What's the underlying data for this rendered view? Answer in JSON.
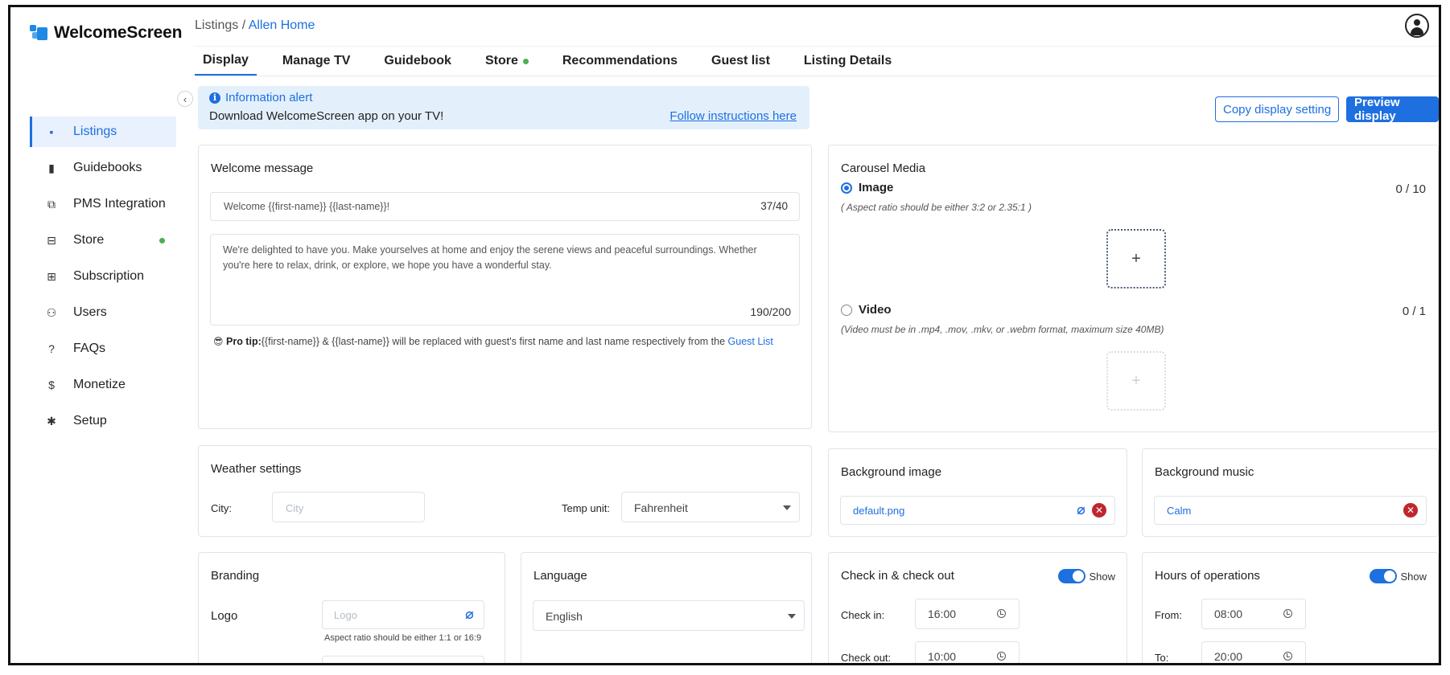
{
  "app": {
    "name": "WelcomeScreen"
  },
  "sidebar": {
    "items": [
      {
        "label": "Listings",
        "icon": "listings-icon",
        "glyph": "▪"
      },
      {
        "label": "Guidebooks",
        "icon": "book-icon",
        "glyph": "▮"
      },
      {
        "label": "PMS Integration",
        "icon": "puzzle-icon",
        "glyph": "⧉"
      },
      {
        "label": "Store",
        "icon": "store-icon",
        "glyph": "⊟"
      },
      {
        "label": "Subscription",
        "icon": "subscription-icon",
        "glyph": "⊞"
      },
      {
        "label": "Users",
        "icon": "users-icon",
        "glyph": "⚇"
      },
      {
        "label": "FAQs",
        "icon": "question-icon",
        "glyph": "?"
      },
      {
        "label": "Monetize",
        "icon": "dollar-icon",
        "glyph": "$"
      },
      {
        "label": "Setup",
        "icon": "gear-icon",
        "glyph": "✱"
      }
    ],
    "collapse_glyph": "‹"
  },
  "header": {
    "breadcrumb_root": "Listings /",
    "breadcrumb_current": "Allen Home"
  },
  "tabs": [
    "Display",
    "Manage TV",
    "Guidebook",
    "Store",
    "Recommendations",
    "Guest list",
    "Listing Details"
  ],
  "alert": {
    "title": "Information alert",
    "info_glyph": "i",
    "text": "Download WelcomeScreen app on your TV!",
    "link": "Follow instructions here"
  },
  "actions": {
    "copy": "Copy display setting",
    "preview": "Preview display"
  },
  "welcome": {
    "title": "Welcome message",
    "headline": "Welcome {{first-name}} {{last-name}}!",
    "headline_count": "37/40",
    "body": "We're delighted to have you. Make yourselves at home and enjoy the serene views and peaceful surroundings. Whether you're here to relax, drink, or explore, we hope you have a wonderful stay.",
    "body_count": "190/200",
    "tip_emoji": "😎",
    "tip_label": "Pro tip:",
    "tip_text": "{{first-name}} & {{last-name}} will be replaced with guest's first name and last name respectively from the",
    "tip_link": "Guest List"
  },
  "carousel": {
    "title": "Carousel Media",
    "image_label": "Image",
    "image_count": "0 / 10",
    "image_hint": "( Aspect ratio should be either 3:2 or 2.35:1 )",
    "video_label": "Video",
    "video_count": "0 / 1",
    "video_hint": "(Video must be in .mp4, .mov, .mkv, or .webm format, maximum size 40MB)",
    "plus": "+"
  },
  "weather": {
    "title": "Weather settings",
    "city_label": "City:",
    "city_placeholder": "City",
    "temp_label": "Temp unit:",
    "temp_value": "Fahrenheit"
  },
  "background_image": {
    "title": "Background image",
    "value": "default.png"
  },
  "background_music": {
    "title": "Background music",
    "value": "Calm"
  },
  "branding": {
    "title": "Branding",
    "logo_label": "Logo",
    "logo_placeholder": "Logo",
    "logo_hint": "Aspect ratio should be either 1:1 or 16:9"
  },
  "language": {
    "title": "Language",
    "value": "English"
  },
  "checkin": {
    "title": "Check in & check out",
    "toggle_label": "Show",
    "in_label": "Check in:",
    "in_value": "16:00",
    "out_label": "Check out:",
    "out_value": "10:00"
  },
  "hours": {
    "title": "Hours of operations",
    "toggle_label": "Show",
    "from_label": "From:",
    "from_value": "08:00",
    "to_label": "To:",
    "to_value": "20:00"
  },
  "icons": {
    "remove": "✕",
    "clip": "⌀"
  },
  "colors": {
    "accent": "#1e6fe0",
    "status_green": "#4caf50",
    "danger": "#c0262d",
    "alert_bg": "#e3f0fc"
  }
}
